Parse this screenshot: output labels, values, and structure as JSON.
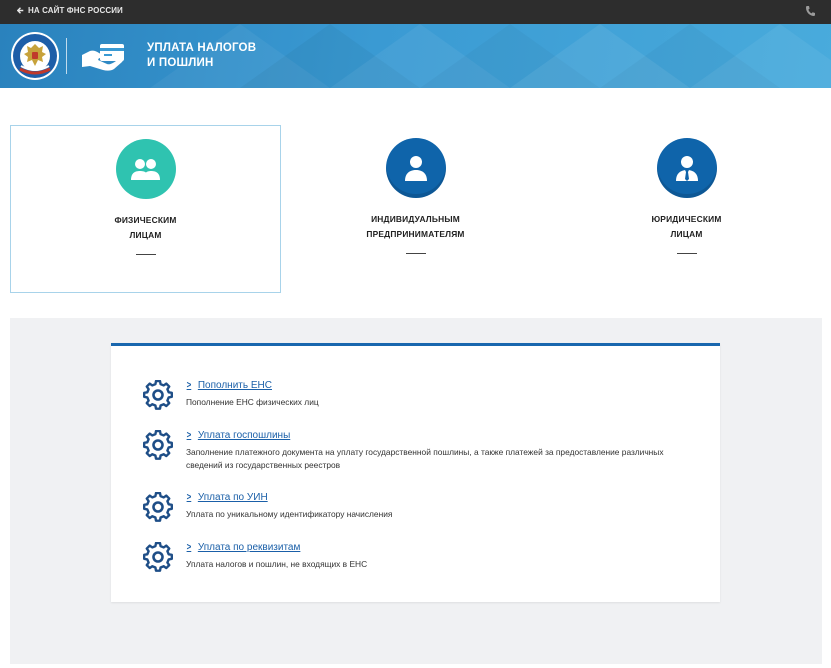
{
  "topbar": {
    "back_link": "НА САЙТ ФНС РОССИИ",
    "back_icon": "arrow-left-icon",
    "phone_icon": "phone-icon"
  },
  "header": {
    "title_line1": "УПЛАТА НАЛОГОВ",
    "title_line2": "И ПОШЛИН",
    "emblem": "fns-emblem-logo",
    "service_icon": "hand-card-icon"
  },
  "categories": [
    {
      "line1": "ФИЗИЧЕСКИМ",
      "line2": "ЛИЦАМ",
      "icon": "people-icon",
      "color": "#2fc3b0",
      "active": true
    },
    {
      "line1": "ИНДИВИДУАЛЬНЫМ",
      "line2": "ПРЕДПРИНИМАТЕЛЯМ",
      "icon": "person-icon",
      "color": "#0f64aa",
      "active": false
    },
    {
      "line1": "ЮРИДИЧЕСКИМ",
      "line2": "ЛИЦАМ",
      "icon": "person-tie-icon",
      "color": "#0f64aa",
      "active": false
    }
  ],
  "services": [
    {
      "title": "Пополнить ЕНС",
      "description": "Пополнение ЕНС физических лиц",
      "icon": "gear-icon"
    },
    {
      "title": "Уплата госпошлины",
      "description": "Заполнение платежного документа на уплату государственной пошлины, а также платежей за предоставление различных сведений из государственных реестров",
      "icon": "gear-icon"
    },
    {
      "title": "Уплата по УИН",
      "description": "Уплата по уникальному идентификатору начисления",
      "icon": "gear-icon"
    },
    {
      "title": "Уплата по реквизитам",
      "description": "Уплата налогов и пошлин, не входящих в ЕНС",
      "icon": "gear-icon"
    }
  ],
  "colors": {
    "topbar": "#2d2d2d",
    "header": "#3a9ad3",
    "accent_blue": "#1967ae",
    "teal": "#2fc3b0",
    "link": "#1a5fa8",
    "panel_bg": "#f0f1f3"
  }
}
